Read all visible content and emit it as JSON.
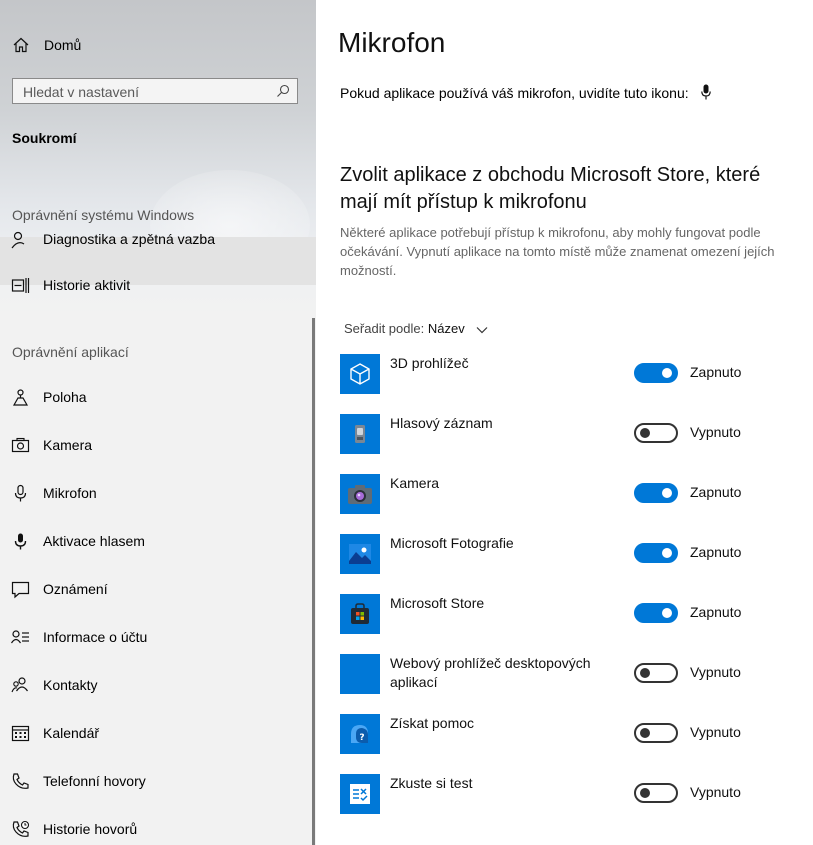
{
  "sidebar": {
    "home_label": "Domů",
    "search_placeholder": "Hledat v nastavení",
    "section_title": "Soukromí",
    "group_system": "Oprávnění systému Windows",
    "system_items": [
      {
        "label": "Diagnostika a zpětná vazba",
        "icon": "feedback-icon"
      },
      {
        "label": "Historie aktivit",
        "icon": "activity-history-icon"
      }
    ],
    "group_apps": "Oprávnění aplikací",
    "app_items": [
      {
        "label": "Poloha",
        "icon": "location-icon"
      },
      {
        "label": "Kamera",
        "icon": "camera-icon"
      },
      {
        "label": "Mikrofon",
        "icon": "microphone-icon"
      },
      {
        "label": "Aktivace hlasem",
        "icon": "voice-activation-icon"
      },
      {
        "label": "Oznámení",
        "icon": "notification-icon"
      },
      {
        "label": "Informace o účtu",
        "icon": "account-info-icon"
      },
      {
        "label": "Kontakty",
        "icon": "contacts-icon"
      },
      {
        "label": "Kalendář",
        "icon": "calendar-icon"
      },
      {
        "label": "Telefonní hovory",
        "icon": "phone-icon"
      },
      {
        "label": "Historie hovorů",
        "icon": "call-history-icon"
      }
    ]
  },
  "main": {
    "title": "Mikrofon",
    "info_text": "Pokud aplikace používá váš mikrofon, uvidíte tuto ikonu:",
    "sub_heading": "Zvolit aplikace z obchodu Microsoft Store, které mají mít přístup k mikrofonu",
    "description": "Některé aplikace potřebují přístup k mikrofonu, aby mohly fungovat podle očekávání. Vypnutí aplikace na tomto místě může znamenat omezení jejích možností.",
    "sort_label": "Seřadit podle:",
    "sort_value": "Název",
    "apps": [
      {
        "name": "3D prohlížeč",
        "state": "Zapnuto",
        "on": true,
        "icon": "3d-viewer-icon"
      },
      {
        "name": "Hlasový záznam",
        "state": "Vypnuto",
        "on": false,
        "icon": "voice-recorder-icon"
      },
      {
        "name": "Kamera",
        "state": "Zapnuto",
        "on": true,
        "icon": "camera-app-icon"
      },
      {
        "name": "Microsoft Fotografie",
        "state": "Zapnuto",
        "on": true,
        "icon": "photos-icon"
      },
      {
        "name": "Microsoft Store",
        "state": "Zapnuto",
        "on": true,
        "icon": "store-icon"
      },
      {
        "name": "Webový prohlížeč desktopových aplikací",
        "state": "Vypnuto",
        "on": false,
        "icon": "desktop-web-viewer-icon"
      },
      {
        "name": "Získat pomoc",
        "state": "Vypnuto",
        "on": false,
        "icon": "get-help-icon"
      },
      {
        "name": "Zkuste si test",
        "state": "Vypnuto",
        "on": false,
        "icon": "take-a-test-icon"
      }
    ],
    "colors": {
      "accent": "#0078d7",
      "toggle_off": "#333333"
    }
  }
}
